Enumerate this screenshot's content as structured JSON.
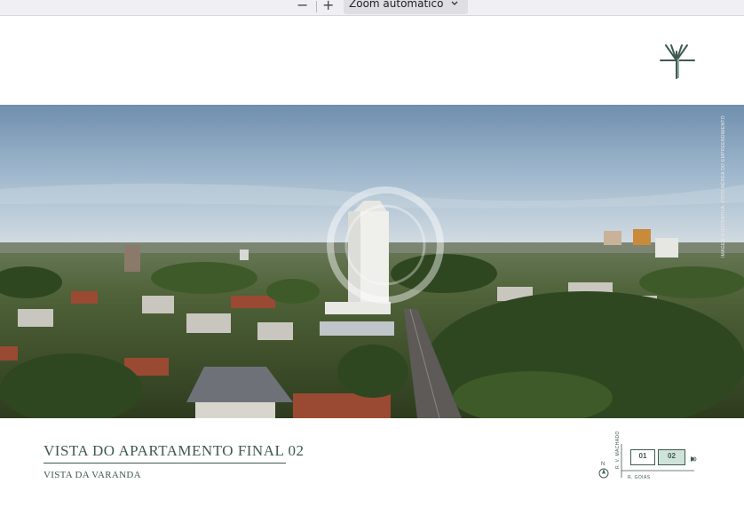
{
  "toolbar": {
    "zoom_out_label": "−",
    "zoom_in_label": "+",
    "zoom_select_value": "Zoom automático"
  },
  "page": {
    "title": "Vista do apartamento final 02",
    "subtitle": "VISTA DA VARANDA",
    "photo_credit": "IMAGEM ILUSTRATIVA. FOTO AÉREA DO EMPREENDIMENTO"
  },
  "site_map": {
    "street_vertical": "R. V. MACHADO",
    "street_horizontal": "R. GOIÁS",
    "unit_01": "01",
    "unit_02": "02",
    "north_label": "N"
  },
  "colors": {
    "brand_green": "#3f5a50",
    "highlight_unit": "#cfe3d8"
  }
}
